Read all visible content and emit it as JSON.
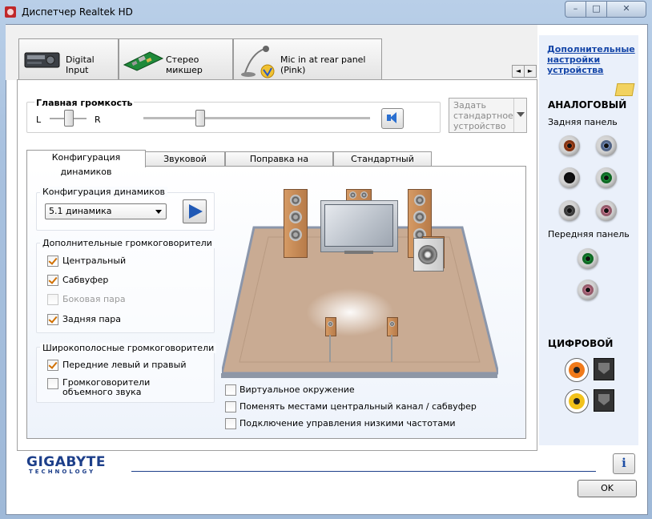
{
  "window": {
    "title": "Диспетчер Realtek HD",
    "min_glyph": "–",
    "max_glyph": "□",
    "close_glyph": "✕"
  },
  "device_tabs": [
    {
      "label": "Digital Input",
      "icon": "audio-device-icon"
    },
    {
      "label": "Стерео микшер",
      "icon": "circuit-board-icon"
    },
    {
      "label": "Mic in at rear panel (Pink)",
      "icon": "microphone-icon"
    }
  ],
  "tab_scroll": {
    "left": "◄",
    "right": "►"
  },
  "volume": {
    "title": "Главная громкость",
    "left_label": "L",
    "right_label": "R",
    "balance_percent": 50,
    "master_percent": 25,
    "set_default_label": "Задать стандартное устройство"
  },
  "inner_tabs": [
    {
      "label": "Конфигурация динамиков",
      "active": true
    },
    {
      "label": "Звуковой эффект",
      "active": false
    },
    {
      "label": "Поправка на помещение",
      "active": false
    },
    {
      "label": "Стандартный формат",
      "active": false
    }
  ],
  "speaker_config": {
    "title": "Конфигурация динамиков",
    "selected": "5.1 динамика"
  },
  "extra_speakers": {
    "title": "Дополнительные громкоговорители",
    "items": [
      {
        "label": "Центральный",
        "checked": true,
        "enabled": true
      },
      {
        "label": "Сабвуфер",
        "checked": true,
        "enabled": true
      },
      {
        "label": "Боковая пара",
        "checked": false,
        "enabled": false
      },
      {
        "label": "Задняя пара",
        "checked": true,
        "enabled": true
      }
    ]
  },
  "wideband": {
    "title": "Широкополосные громкоговорители",
    "items": [
      {
        "label": "Передние левый и правый",
        "checked": true
      },
      {
        "label": "Громкоговорители объемного звука",
        "checked": false
      }
    ]
  },
  "options": [
    {
      "label": "Виртуальное окружение",
      "checked": false
    },
    {
      "label": "Поменять местами центральный канал / сабвуфер",
      "checked": false
    },
    {
      "label": "Подключение управления низкими частотами",
      "checked": false
    }
  ],
  "right_panel": {
    "link": "Дополнительные настройки устройства",
    "analog_title": "АНАЛОГОВЫЙ",
    "rear_title": "Задняя панель",
    "front_title": "Передняя панель",
    "digital_title": "ЦИФРОВОЙ",
    "rear_jacks": [
      "#c8501e",
      "#7f9bd0",
      "#141414",
      "#1aa23a",
      "#5a5a5a",
      "#e58aa4"
    ],
    "front_jacks": [
      "#1aa23a",
      "#e58aa4"
    ],
    "digital_colors": {
      "coax_out": "#f07a1a",
      "coax_in": "#f2c21a"
    }
  },
  "footer": {
    "brand": "GIGABYTE",
    "brand_sub": "TECHNOLOGY",
    "info_glyph": "i",
    "ok_label": "OK"
  },
  "colors": {
    "floor": "#c9ab93",
    "floor_edge": "#8b96ab",
    "link": "#1546a8",
    "brand": "#1d3f8a"
  }
}
